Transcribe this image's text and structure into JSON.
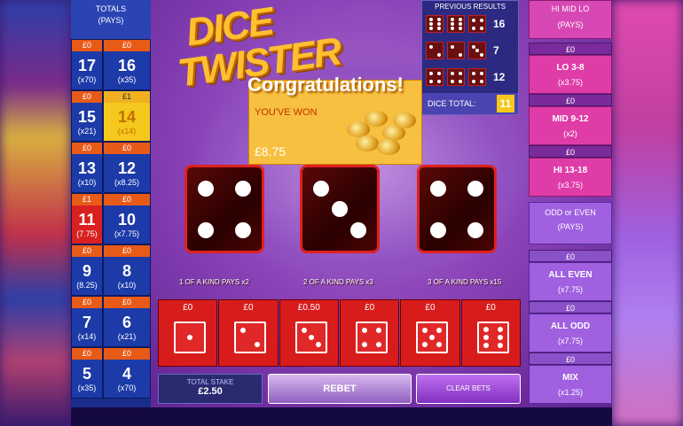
{
  "colors": {
    "accent": "#e03ca8",
    "stake": "#e85a18",
    "die": "#d81c1c",
    "highlight": "#f4c81c",
    "panel_blue": "#1c3aa8"
  },
  "logo": {
    "line1": "DICE",
    "line2": "TWISTER"
  },
  "totals_panel": {
    "header": "TOTALS",
    "header_sub": "(PAYS)",
    "cells": [
      {
        "stake": "£0",
        "num": "17",
        "odds": "(x70)"
      },
      {
        "stake": "£0",
        "num": "16",
        "odds": "(x35)"
      },
      {
        "stake": "£0",
        "num": "15",
        "odds": "(x21)"
      },
      {
        "stake": "£1",
        "num": "14",
        "odds": "(x14)"
      },
      {
        "stake": "£0",
        "num": "13",
        "odds": "(x10)"
      },
      {
        "stake": "£0",
        "num": "12",
        "odds": "(x8.25)"
      },
      {
        "stake": "£1",
        "num": "11",
        "odds": "(7.75)"
      },
      {
        "stake": "£0",
        "num": "10",
        "odds": "(x7.75)"
      },
      {
        "stake": "£0",
        "num": "9",
        "odds": "(8.25)"
      },
      {
        "stake": "£0",
        "num": "8",
        "odds": "(x10)"
      },
      {
        "stake": "£0",
        "num": "7",
        "odds": "(x14)"
      },
      {
        "stake": "£0",
        "num": "6",
        "odds": "(x21)"
      },
      {
        "stake": "£0",
        "num": "5",
        "odds": "(x35)"
      },
      {
        "stake": "£0",
        "num": "4",
        "odds": "(x70)"
      }
    ]
  },
  "previous_results": {
    "title": "PREVIOUS RESULTS",
    "totals": [
      "16",
      "7",
      "12"
    ],
    "dice_total_label": "DICE TOTAL:",
    "dice_total_value": "11"
  },
  "win": {
    "title": "Congratulations!",
    "subtitle": "YOU'VE WON",
    "amount": "£8.75"
  },
  "big_dice": [
    4,
    3,
    4
  ],
  "pays_labels": [
    "1 OF A KIND PAYS x2",
    "2 OF A KIND PAYS x3",
    "3 OF A KIND PAYS x15"
  ],
  "bet_dice": [
    {
      "stake": "£0",
      "face": 1
    },
    {
      "stake": "£0",
      "face": 2
    },
    {
      "stake": "£0.50",
      "face": 3
    },
    {
      "stake": "£0",
      "face": 4
    },
    {
      "stake": "£0",
      "face": 5
    },
    {
      "stake": "£0",
      "face": 6
    }
  ],
  "right_panel": {
    "hml_header": "HI MID LO",
    "hml_sub": "(PAYS)",
    "bets": [
      {
        "stake": "£0",
        "label": "LO 3-8",
        "odds": "(x3.75)"
      },
      {
        "stake": "£0",
        "label": "MID 9-12",
        "odds": "(x2)"
      },
      {
        "stake": "£0",
        "label": "HI 13-18",
        "odds": "(x3.75)"
      }
    ],
    "oe_header": "ODD or EVEN",
    "oe_sub": "(PAYS)",
    "oe_bets": [
      {
        "stake": "£0",
        "label": "ALL EVEN",
        "odds": "(x7.75)"
      },
      {
        "stake": "£0",
        "label": "ALL ODD",
        "odds": "(x7.75)"
      },
      {
        "stake": "£0",
        "label": "MIX",
        "odds": "(x1.25)"
      }
    ]
  },
  "controls": {
    "total_stake_label": "TOTAL STAKE",
    "total_stake_value": "£2.50",
    "rebet": "REBET",
    "clear_bets": "CLEAR BETS"
  }
}
